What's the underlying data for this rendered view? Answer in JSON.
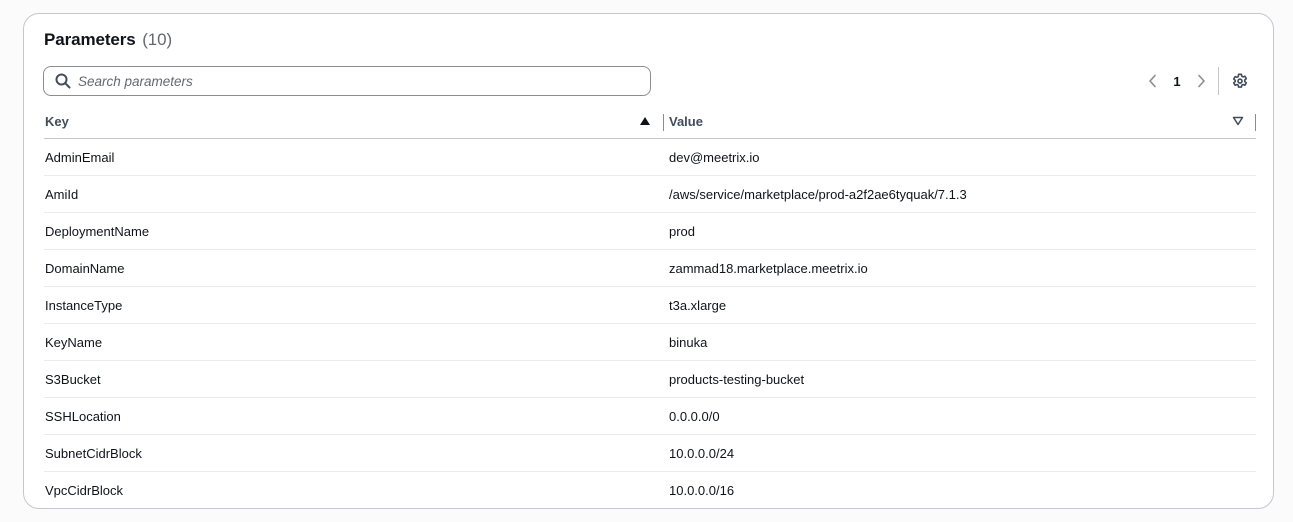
{
  "header": {
    "title": "Parameters",
    "count": "(10)"
  },
  "search": {
    "placeholder": "Search parameters",
    "value": ""
  },
  "pagination": {
    "current_page": "1"
  },
  "table": {
    "columns": [
      {
        "label": "Key",
        "sort": "ascending"
      },
      {
        "label": "Value",
        "sort": "none"
      }
    ],
    "rows": [
      {
        "key": "AdminEmail",
        "value": "dev@meetrix.io"
      },
      {
        "key": "AmiId",
        "value": "/aws/service/marketplace/prod-a2f2ae6tyquak/7.1.3"
      },
      {
        "key": "DeploymentName",
        "value": "prod"
      },
      {
        "key": "DomainName",
        "value": "zammad18.marketplace.meetrix.io"
      },
      {
        "key": "InstanceType",
        "value": "t3a.xlarge"
      },
      {
        "key": "KeyName",
        "value": "binuka"
      },
      {
        "key": "S3Bucket",
        "value": "products-testing-bucket"
      },
      {
        "key": "SSHLocation",
        "value": "0.0.0.0/0"
      },
      {
        "key": "SubnetCidrBlock",
        "value": "10.0.0.0/24"
      },
      {
        "key": "VpcCidrBlock",
        "value": "10.0.0.0/16"
      }
    ]
  },
  "icons": {
    "search": "search-icon",
    "prev": "chevron-left-icon",
    "next": "chevron-right-icon",
    "settings": "gear-icon",
    "sort_asc": "caret-up-filled-icon",
    "sort_none": "caret-down-outline-icon"
  },
  "colors": {
    "text": "#0f141a",
    "muted": "#656871",
    "border": "#c6c6cd"
  }
}
